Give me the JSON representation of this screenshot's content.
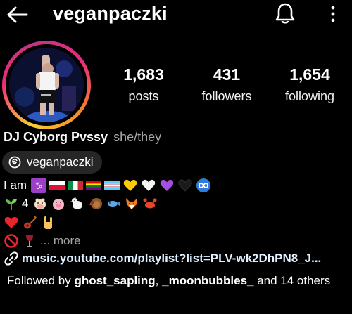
{
  "header": {
    "username": "veganpaczki",
    "back_icon": "back-arrow-icon",
    "bell_icon": "bell-icon",
    "more_icon": "more-vertical-icon"
  },
  "stats": {
    "posts_count": "1,683",
    "posts_label": "posts",
    "followers_count": "431",
    "followers_label": "followers",
    "following_count": "1,654",
    "following_label": "following"
  },
  "profile": {
    "display_name": "DJ Cyborg Pvssy",
    "pronouns": "she/they",
    "threads_handle": "veganpaczki"
  },
  "bio": {
    "line1_prefix": "I am",
    "line2_prefix": "4",
    "more_label": "... more",
    "link": "music.youtube.com/playlist?list=PLV-wk2DhPN8_J..."
  },
  "followed_by": {
    "prefix": "Followed by ",
    "user1": "ghost_sapling",
    "separator": ", ",
    "user2": "_moonbubbles_",
    "suffix": " and 14 others"
  },
  "colors": {
    "background": "#000000",
    "secondary_text": "#a8a8a8",
    "badge_background": "#262626"
  }
}
